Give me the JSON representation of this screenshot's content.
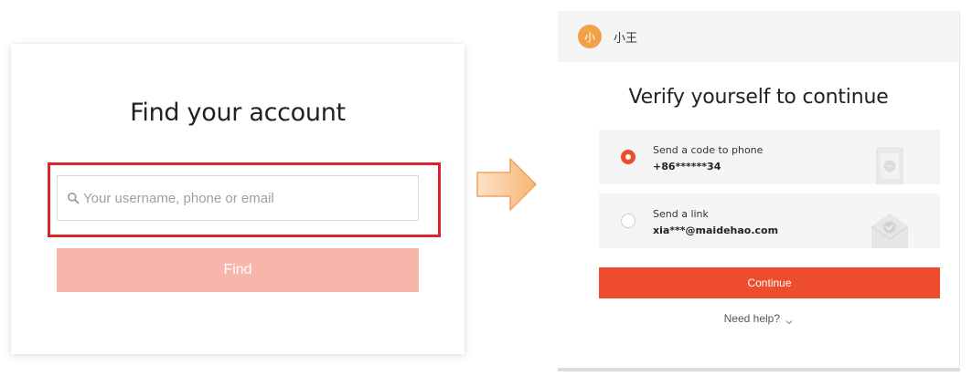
{
  "find_account": {
    "title": "Find your account",
    "search_placeholder": "Your username, phone or email",
    "search_value": "",
    "find_button_label": "Find",
    "colors": {
      "highlight_border": "#d9232d",
      "find_button_disabled": "#f7b6aa"
    }
  },
  "transition_arrow": {
    "icon": "right-arrow-icon",
    "color": "#f7b577"
  },
  "verify": {
    "user": {
      "avatar_text": "小",
      "name": "小王"
    },
    "title": "Verify yourself to continue",
    "options": [
      {
        "label": "Send a code to phone",
        "value": "+86******34",
        "selected": true,
        "icon": "phone-message-icon"
      },
      {
        "label": "Send a link",
        "value": "xia***@maidehao.com",
        "selected": false,
        "icon": "envelope-check-icon"
      }
    ],
    "continue_label": "Continue",
    "help_label": "Need help?",
    "colors": {
      "accent": "#ee4d2d",
      "avatar": "#f2a14a"
    }
  }
}
